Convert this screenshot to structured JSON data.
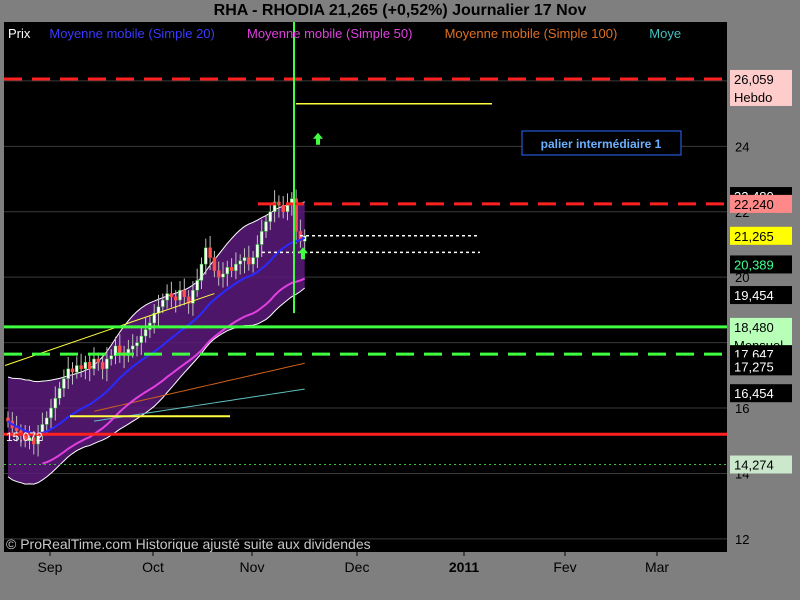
{
  "title": "RHA - RHODIA     21,265 (+0,52%)     Journalier  17 Nov",
  "legend": [
    {
      "text": "Prix",
      "color": "#ffffff"
    },
    {
      "text": "Moyenne mobile (Simple 20)",
      "color": "#3a3aff"
    },
    {
      "text": "Moyenne mobile (Simple 50)",
      "color": "#e040e0"
    },
    {
      "text": "Moyenne mobile (Simple 100)",
      "color": "#e07020"
    },
    {
      "text": "Moye",
      "color": "#40c0c0"
    }
  ],
  "footer": "© ProRealTime.com Historique ajusté suite aux dividendes",
  "annotation": "palier intermédiaire 1",
  "low_label": "15,072",
  "chart_data": {
    "type": "candlestick",
    "y_ticks": [
      12,
      14,
      16,
      18,
      20,
      22,
      24,
      26
    ],
    "ylim": [
      11.6,
      27.8
    ],
    "x_labels": [
      "Sep",
      "Oct",
      "Nov",
      "Dec",
      "2011",
      "Fev",
      "Mar"
    ],
    "price_labels": [
      {
        "value": "26,059",
        "sub": "Hebdo",
        "y": 26.059,
        "bg": "#ffcccc",
        "fg": "#000000"
      },
      {
        "value": "22,480",
        "y": 22.48,
        "bg": "#000000",
        "fg": "#ffffff"
      },
      {
        "value": "22,240",
        "y": 22.24,
        "bg": "#ff8888",
        "fg": "#000000"
      },
      {
        "value": "21,265",
        "y": 21.265,
        "bg": "#ffff00",
        "fg": "#000000"
      },
      {
        "value": "20,389",
        "y": 20.389,
        "bg": "#000000",
        "fg": "#40ff90"
      },
      {
        "value": "19,454",
        "y": 19.454,
        "bg": "#000000",
        "fg": "#ffffff"
      },
      {
        "value": "18,480",
        "sub": "Mensuel",
        "y": 18.48,
        "bg": "#b8ffb8",
        "fg": "#000000"
      },
      {
        "value": "17,647",
        "y": 17.647,
        "bg": "#000000",
        "fg": "#ffffff"
      },
      {
        "value": "17,275",
        "y": 17.275,
        "bg": "#000000",
        "fg": "#ffffff"
      },
      {
        "value": "16,454",
        "y": 16.454,
        "bg": "#000000",
        "fg": "#ffffff"
      },
      {
        "value": "14,274",
        "y": 14.274,
        "bg": "#cce8cc",
        "fg": "#000000"
      }
    ],
    "closes": [
      15.6,
      15.4,
      15.3,
      15.2,
      15.0,
      15.1,
      14.9,
      15.2,
      15.5,
      15.7,
      16.0,
      16.3,
      16.6,
      16.9,
      17.2,
      17.1,
      17.3,
      17.2,
      17.4,
      17.2,
      17.5,
      17.4,
      17.2,
      17.5,
      17.6,
      17.9,
      17.7,
      17.6,
      17.8,
      17.9,
      18.0,
      18.2,
      18.4,
      18.6,
      18.9,
      19.1,
      19.3,
      19.5,
      19.4,
      19.3,
      19.6,
      19.4,
      19.2,
      19.6,
      19.9,
      20.4,
      20.9,
      20.6,
      20.2,
      20.0,
      20.1,
      20.3,
      20.2,
      20.4,
      20.5,
      20.6,
      20.4,
      20.6,
      21.0,
      21.4,
      21.7,
      22.0,
      22.3,
      22.2,
      22.0,
      22.2,
      22.4,
      21.4,
      21.1,
      21.265
    ],
    "levels": {
      "red_dashed_top": 26.059,
      "red_dashed_mid": 22.24,
      "yellow_segment": 25.3,
      "white_dotted_1": 21.265,
      "white_dotted_2": 20.76,
      "green_solid": 18.48,
      "green_dashed": 17.647,
      "red_solid": 15.2,
      "green_dotted": 14.274,
      "yellow_low": 15.75
    }
  }
}
